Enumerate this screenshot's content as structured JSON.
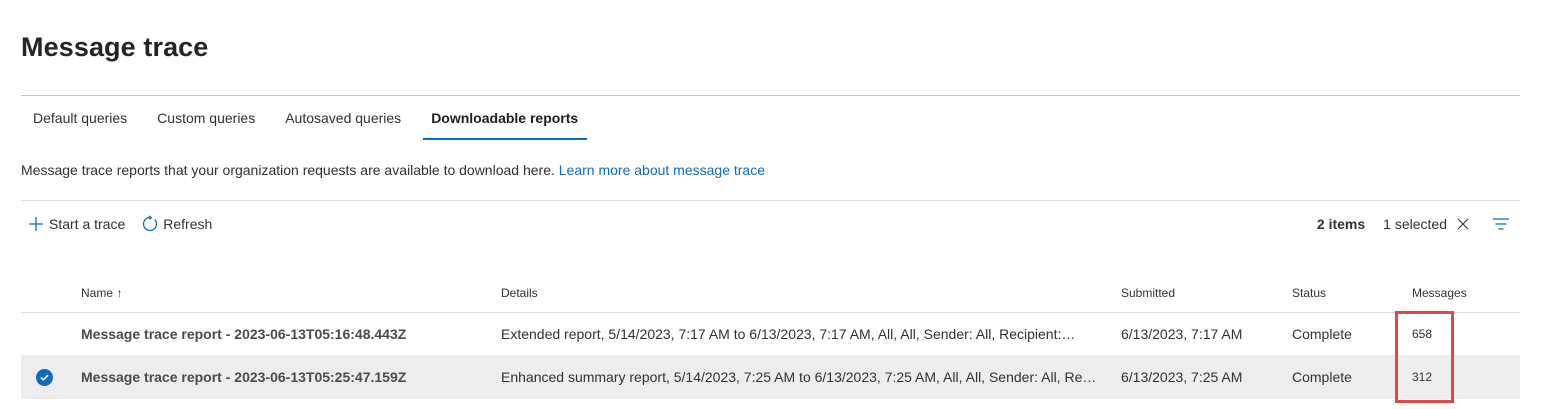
{
  "page": {
    "title": "Message trace"
  },
  "tabs": [
    {
      "label": "Default queries",
      "active": false
    },
    {
      "label": "Custom queries",
      "active": false
    },
    {
      "label": "Autosaved queries",
      "active": false
    },
    {
      "label": "Downloadable reports",
      "active": true
    }
  ],
  "description": {
    "text": "Message trace reports that your organization requests are available to download here. ",
    "link": "Learn more about message trace"
  },
  "toolbar": {
    "start_trace": "Start a trace",
    "refresh": "Refresh",
    "items_count": "2 items",
    "selected_count": "1 selected"
  },
  "table": {
    "columns": {
      "name": "Name ↑",
      "details": "Details",
      "submitted": "Submitted",
      "status": "Status",
      "messages": "Messages"
    },
    "rows": [
      {
        "name": "Message trace report - 2023-06-13T05:16:48.443Z",
        "details": "Extended report, 5/14/2023, 7:17 AM to 6/13/2023, 7:17 AM, All, All, Sender: All, Recipient:",
        "details_tail": ".",
        "submitted": "6/13/2023, 7:17 AM",
        "status": "Complete",
        "messages": "658",
        "selected": false
      },
      {
        "name": "Message trace report - 2023-06-13T05:25:47.159Z",
        "details": "Enhanced summary report, 5/14/2023, 7:25 AM to 6/13/2023, 7:25 AM, All, All, Sender: All, Reci...",
        "submitted": "6/13/2023, 7:25 AM",
        "status": "Complete",
        "messages": "312",
        "selected": true
      }
    ]
  },
  "colors": {
    "accent": "#0f6cbd",
    "selected_row": "#ededed",
    "highlight": "#e04848"
  },
  "icons": [
    "add-icon",
    "refresh-icon",
    "close-icon",
    "filter-icon",
    "checkmark-icon",
    "sort-ascending-icon"
  ]
}
